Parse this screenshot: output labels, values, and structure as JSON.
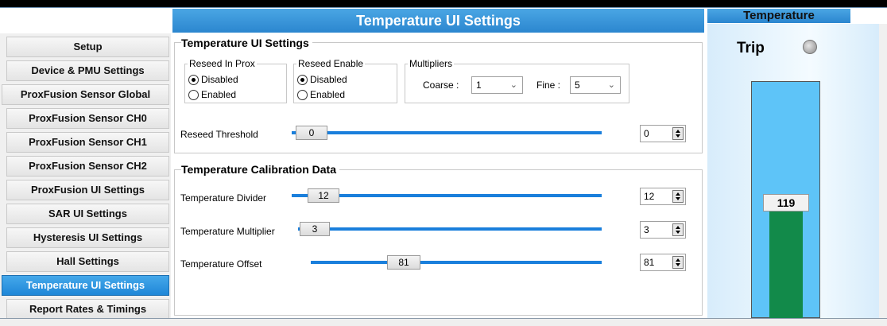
{
  "header": {
    "title": "Temperature UI Settings"
  },
  "sidebar": {
    "items": [
      {
        "label": "Setup",
        "active": false
      },
      {
        "label": "Device & PMU Settings",
        "active": false
      },
      {
        "label": "ProxFusion Sensor Global",
        "active": false
      },
      {
        "label": "ProxFusion Sensor CH0",
        "active": false
      },
      {
        "label": "ProxFusion Sensor CH1",
        "active": false
      },
      {
        "label": "ProxFusion Sensor CH2",
        "active": false
      },
      {
        "label": "ProxFusion UI Settings",
        "active": false
      },
      {
        "label": "SAR UI Settings",
        "active": false
      },
      {
        "label": "Hysteresis UI Settings",
        "active": false
      },
      {
        "label": "Hall Settings",
        "active": false
      },
      {
        "label": "Temperature UI Settings",
        "active": true
      },
      {
        "label": "Report Rates & Timings",
        "active": false
      }
    ]
  },
  "settings": {
    "group_title": "Temperature UI Settings",
    "reseed_in_prox": {
      "title": "Reseed In Prox",
      "options": [
        "Disabled",
        "Enabled"
      ],
      "selected": "Disabled"
    },
    "reseed_enable": {
      "title": "Reseed Enable",
      "options": [
        "Disabled",
        "Enabled"
      ],
      "selected": "Disabled"
    },
    "multipliers": {
      "title": "Multipliers",
      "coarse_label": "Coarse :",
      "coarse_value": "1",
      "fine_label": "Fine :",
      "fine_value": "5"
    },
    "reseed_threshold": {
      "label": "Reseed Threshold",
      "value": "0",
      "fraction": 0.0
    }
  },
  "calibration": {
    "group_title": "Temperature Calibration Data",
    "divider": {
      "label": "Temperature Divider",
      "value": "12",
      "fraction": 0.05
    },
    "multiplier": {
      "label": "Temperature Multiplier",
      "value": "3",
      "fraction": 0.01
    },
    "offset": {
      "label": "Temperature Offset",
      "value": "81",
      "fraction": 0.32
    }
  },
  "temperature_panel": {
    "title": "Temperature",
    "trip_label": "Trip",
    "reading": "119",
    "fill_fraction": 0.45
  },
  "colors": {
    "accent": "#2b86cf",
    "track": "#1a7fdc",
    "fill": "#128a4a",
    "thermo": "#5ec4f8"
  }
}
